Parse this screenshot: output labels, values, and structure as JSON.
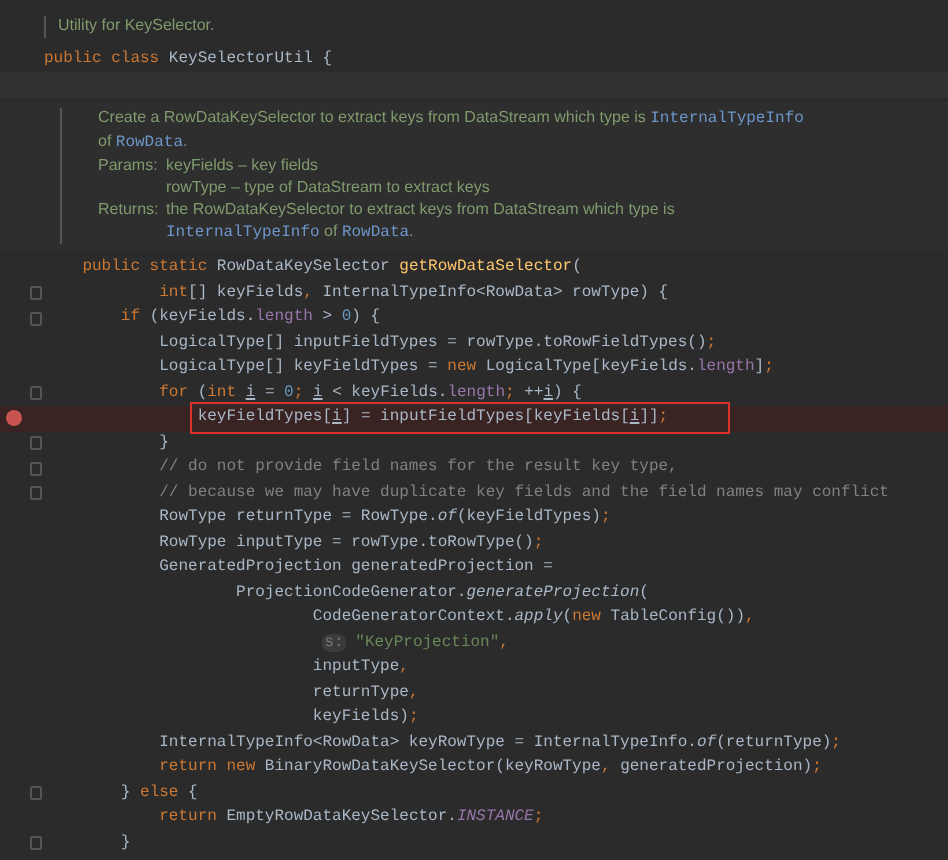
{
  "editor": {
    "lines": [
      {
        "kind": "doc",
        "rows": [
          {
            "lines": [
              [
                {
                  "kind": "text",
                  "text": "Utility for KeySelector."
                }
              ]
            ]
          }
        ]
      },
      {
        "kind": "code",
        "breakpoint": false,
        "outlined": false,
        "fold": false,
        "tokens": [
          {
            "kind": "kw",
            "text": "public class "
          },
          {
            "kind": "plain",
            "text": "KeySelectorUtil {"
          }
        ]
      },
      {
        "kind": "blank",
        "current": true
      },
      {
        "kind": "doc",
        "rows": [
          {
            "lines": [
              [
                {
                  "kind": "text",
                  "text": "Create a RowDataKeySelector to extract keys from DataStream which type is "
                },
                {
                  "kind": "code",
                  "text": "InternalTypeInfo"
                }
              ],
              [
                {
                  "kind": "text",
                  "text": "of "
                },
                {
                  "kind": "code",
                  "text": "RowData"
                },
                {
                  "kind": "text",
                  "text": "."
                }
              ]
            ]
          },
          {
            "label": "Params:",
            "lines": [
              [
                {
                  "kind": "text",
                  "text": "keyFields – key fields"
                }
              ],
              [
                {
                  "kind": "text",
                  "text": "rowType – type of DataStream to extract keys"
                }
              ]
            ]
          },
          {
            "label": "Returns:",
            "lines": [
              [
                {
                  "kind": "text",
                  "text": "the RowDataKeySelector to extract keys from DataStream which type is"
                }
              ],
              [
                {
                  "kind": "code",
                  "text": "InternalTypeInfo"
                },
                {
                  "kind": "text",
                  "text": " of "
                },
                {
                  "kind": "code",
                  "text": "RowData"
                },
                {
                  "kind": "text",
                  "text": "."
                }
              ]
            ]
          }
        ]
      },
      {
        "kind": "code",
        "breakpoint": false,
        "outlined": false,
        "fold": false,
        "tokens": [
          {
            "kind": "kw",
            "text": "    public static "
          },
          {
            "kind": "plain",
            "text": "RowDataKeySelector "
          },
          {
            "kind": "fn",
            "text": "getRowDataSelector"
          },
          {
            "kind": "plain",
            "text": "("
          }
        ]
      },
      {
        "kind": "code",
        "breakpoint": false,
        "outlined": false,
        "fold": true,
        "tokens": [
          {
            "kind": "kw",
            "text": "            int"
          },
          {
            "kind": "plain",
            "text": "[] keyFields"
          },
          {
            "kind": "kw",
            "text": ","
          },
          {
            "kind": "plain",
            "text": " InternalTypeInfo<RowData> rowType) {"
          }
        ]
      },
      {
        "kind": "code",
        "breakpoint": false,
        "outlined": false,
        "fold": true,
        "tokens": [
          {
            "kind": "kw",
            "text": "        if"
          },
          {
            "kind": "plain",
            "text": " (keyFields."
          },
          {
            "kind": "field",
            "text": "length"
          },
          {
            "kind": "plain",
            "text": " > "
          },
          {
            "kind": "num",
            "text": "0"
          },
          {
            "kind": "plain",
            "text": ") {"
          }
        ]
      },
      {
        "kind": "code",
        "breakpoint": false,
        "outlined": false,
        "fold": false,
        "tokens": [
          {
            "kind": "plain",
            "text": "            LogicalType[] inputFieldTypes = rowType.toRowFieldTypes()"
          },
          {
            "kind": "kw",
            "text": ";"
          }
        ]
      },
      {
        "kind": "code",
        "breakpoint": false,
        "outlined": false,
        "fold": false,
        "tokens": [
          {
            "kind": "plain",
            "text": "            LogicalType[] keyFieldTypes = "
          },
          {
            "kind": "kw",
            "text": "new"
          },
          {
            "kind": "plain",
            "text": " LogicalType[keyFields."
          },
          {
            "kind": "field",
            "text": "length"
          },
          {
            "kind": "plain",
            "text": "]"
          },
          {
            "kind": "kw",
            "text": ";"
          }
        ]
      },
      {
        "kind": "code",
        "breakpoint": false,
        "outlined": false,
        "fold": true,
        "tokens": [
          {
            "kind": "kw",
            "text": "            for"
          },
          {
            "kind": "plain",
            "text": " ("
          },
          {
            "kind": "kw",
            "text": "int "
          },
          {
            "kind": "local",
            "text": "i"
          },
          {
            "kind": "plain",
            "text": " = "
          },
          {
            "kind": "num",
            "text": "0"
          },
          {
            "kind": "kw",
            "text": "; "
          },
          {
            "kind": "local",
            "text": "i"
          },
          {
            "kind": "plain",
            "text": " < keyFields."
          },
          {
            "kind": "field",
            "text": "length"
          },
          {
            "kind": "kw",
            "text": ";"
          },
          {
            "kind": "plain",
            "text": " ++"
          },
          {
            "kind": "local",
            "text": "i"
          },
          {
            "kind": "plain",
            "text": ") {"
          }
        ]
      },
      {
        "kind": "code",
        "breakpoint": true,
        "outlined": true,
        "fold": false,
        "tokens": [
          {
            "kind": "plain",
            "text": "                keyFieldTypes["
          },
          {
            "kind": "local",
            "text": "i"
          },
          {
            "kind": "plain",
            "text": "] = inputFieldTypes[keyFields["
          },
          {
            "kind": "local",
            "text": "i"
          },
          {
            "kind": "plain",
            "text": "]]"
          },
          {
            "kind": "kw",
            "text": ";"
          }
        ]
      },
      {
        "kind": "code",
        "breakpoint": false,
        "outlined": false,
        "fold": true,
        "tokens": [
          {
            "kind": "plain",
            "text": "            }"
          }
        ]
      },
      {
        "kind": "code",
        "breakpoint": false,
        "outlined": false,
        "fold": true,
        "tokens": [
          {
            "kind": "cmt",
            "text": "            // do not provide field names for the result key type,"
          }
        ]
      },
      {
        "kind": "code",
        "breakpoint": false,
        "outlined": false,
        "fold": true,
        "tokens": [
          {
            "kind": "cmt",
            "text": "            // because we may have duplicate key fields and the field names may conflict"
          }
        ]
      },
      {
        "kind": "code",
        "breakpoint": false,
        "outlined": false,
        "fold": false,
        "tokens": [
          {
            "kind": "plain",
            "text": "            RowType returnType = RowType."
          },
          {
            "kind": "static",
            "text": "of"
          },
          {
            "kind": "plain",
            "text": "(keyFieldTypes)"
          },
          {
            "kind": "kw",
            "text": ";"
          }
        ]
      },
      {
        "kind": "code",
        "breakpoint": false,
        "outlined": false,
        "fold": false,
        "tokens": [
          {
            "kind": "plain",
            "text": "            RowType inputType = rowType.toRowType()"
          },
          {
            "kind": "kw",
            "text": ";"
          }
        ]
      },
      {
        "kind": "code",
        "breakpoint": false,
        "outlined": false,
        "fold": false,
        "tokens": [
          {
            "kind": "plain",
            "text": "            GeneratedProjection generatedProjection ="
          }
        ]
      },
      {
        "kind": "code",
        "breakpoint": false,
        "outlined": false,
        "fold": false,
        "tokens": [
          {
            "kind": "plain",
            "text": "                    ProjectionCodeGenerator."
          },
          {
            "kind": "static",
            "text": "generateProjection"
          },
          {
            "kind": "plain",
            "text": "("
          }
        ]
      },
      {
        "kind": "code",
        "breakpoint": false,
        "outlined": false,
        "fold": false,
        "tokens": [
          {
            "kind": "plain",
            "text": "                            CodeGeneratorContext."
          },
          {
            "kind": "static",
            "text": "apply"
          },
          {
            "kind": "plain",
            "text": "("
          },
          {
            "kind": "kw",
            "text": "new"
          },
          {
            "kind": "plain",
            "text": " TableConfig())"
          },
          {
            "kind": "kw",
            "text": ","
          }
        ]
      },
      {
        "kind": "code",
        "breakpoint": false,
        "outlined": false,
        "fold": false,
        "tokens": [
          {
            "kind": "hint",
            "text": "                             s:"
          },
          {
            "kind": "str",
            "text": " \"KeyProjection\""
          },
          {
            "kind": "kw",
            "text": ","
          }
        ]
      },
      {
        "kind": "code",
        "breakpoint": false,
        "outlined": false,
        "fold": false,
        "tokens": [
          {
            "kind": "plain",
            "text": "                            inputType"
          },
          {
            "kind": "kw",
            "text": ","
          }
        ]
      },
      {
        "kind": "code",
        "breakpoint": false,
        "outlined": false,
        "fold": false,
        "tokens": [
          {
            "kind": "plain",
            "text": "                            returnType"
          },
          {
            "kind": "kw",
            "text": ","
          }
        ]
      },
      {
        "kind": "code",
        "breakpoint": false,
        "outlined": false,
        "fold": false,
        "tokens": [
          {
            "kind": "plain",
            "text": "                            keyFields)"
          },
          {
            "kind": "kw",
            "text": ";"
          }
        ]
      },
      {
        "kind": "code",
        "breakpoint": false,
        "outlined": false,
        "fold": false,
        "tokens": [
          {
            "kind": "plain",
            "text": "            InternalTypeInfo<RowData> keyRowType = InternalTypeInfo."
          },
          {
            "kind": "static",
            "text": "of"
          },
          {
            "kind": "plain",
            "text": "(returnType)"
          },
          {
            "kind": "kw",
            "text": ";"
          }
        ]
      },
      {
        "kind": "code",
        "breakpoint": false,
        "outlined": false,
        "fold": false,
        "tokens": [
          {
            "kind": "kw",
            "text": "            return new"
          },
          {
            "kind": "plain",
            "text": " BinaryRowDataKeySelector(keyRowType"
          },
          {
            "kind": "kw",
            "text": ","
          },
          {
            "kind": "plain",
            "text": " generatedProjection)"
          },
          {
            "kind": "kw",
            "text": ";"
          }
        ]
      },
      {
        "kind": "code",
        "breakpoint": false,
        "outlined": false,
        "fold": true,
        "tokens": [
          {
            "kind": "plain",
            "text": "        } "
          },
          {
            "kind": "kw",
            "text": "else"
          },
          {
            "kind": "plain",
            "text": " {"
          }
        ]
      },
      {
        "kind": "code",
        "breakpoint": false,
        "outlined": false,
        "fold": false,
        "tokens": [
          {
            "kind": "kw",
            "text": "            return"
          },
          {
            "kind": "plain",
            "text": " EmptyRowDataKeySelector."
          },
          {
            "kind": "const",
            "text": "INSTANCE"
          },
          {
            "kind": "kw",
            "text": ";"
          }
        ]
      },
      {
        "kind": "code",
        "breakpoint": false,
        "outlined": false,
        "fold": true,
        "tokens": [
          {
            "kind": "plain",
            "text": "        }"
          }
        ]
      }
    ]
  }
}
